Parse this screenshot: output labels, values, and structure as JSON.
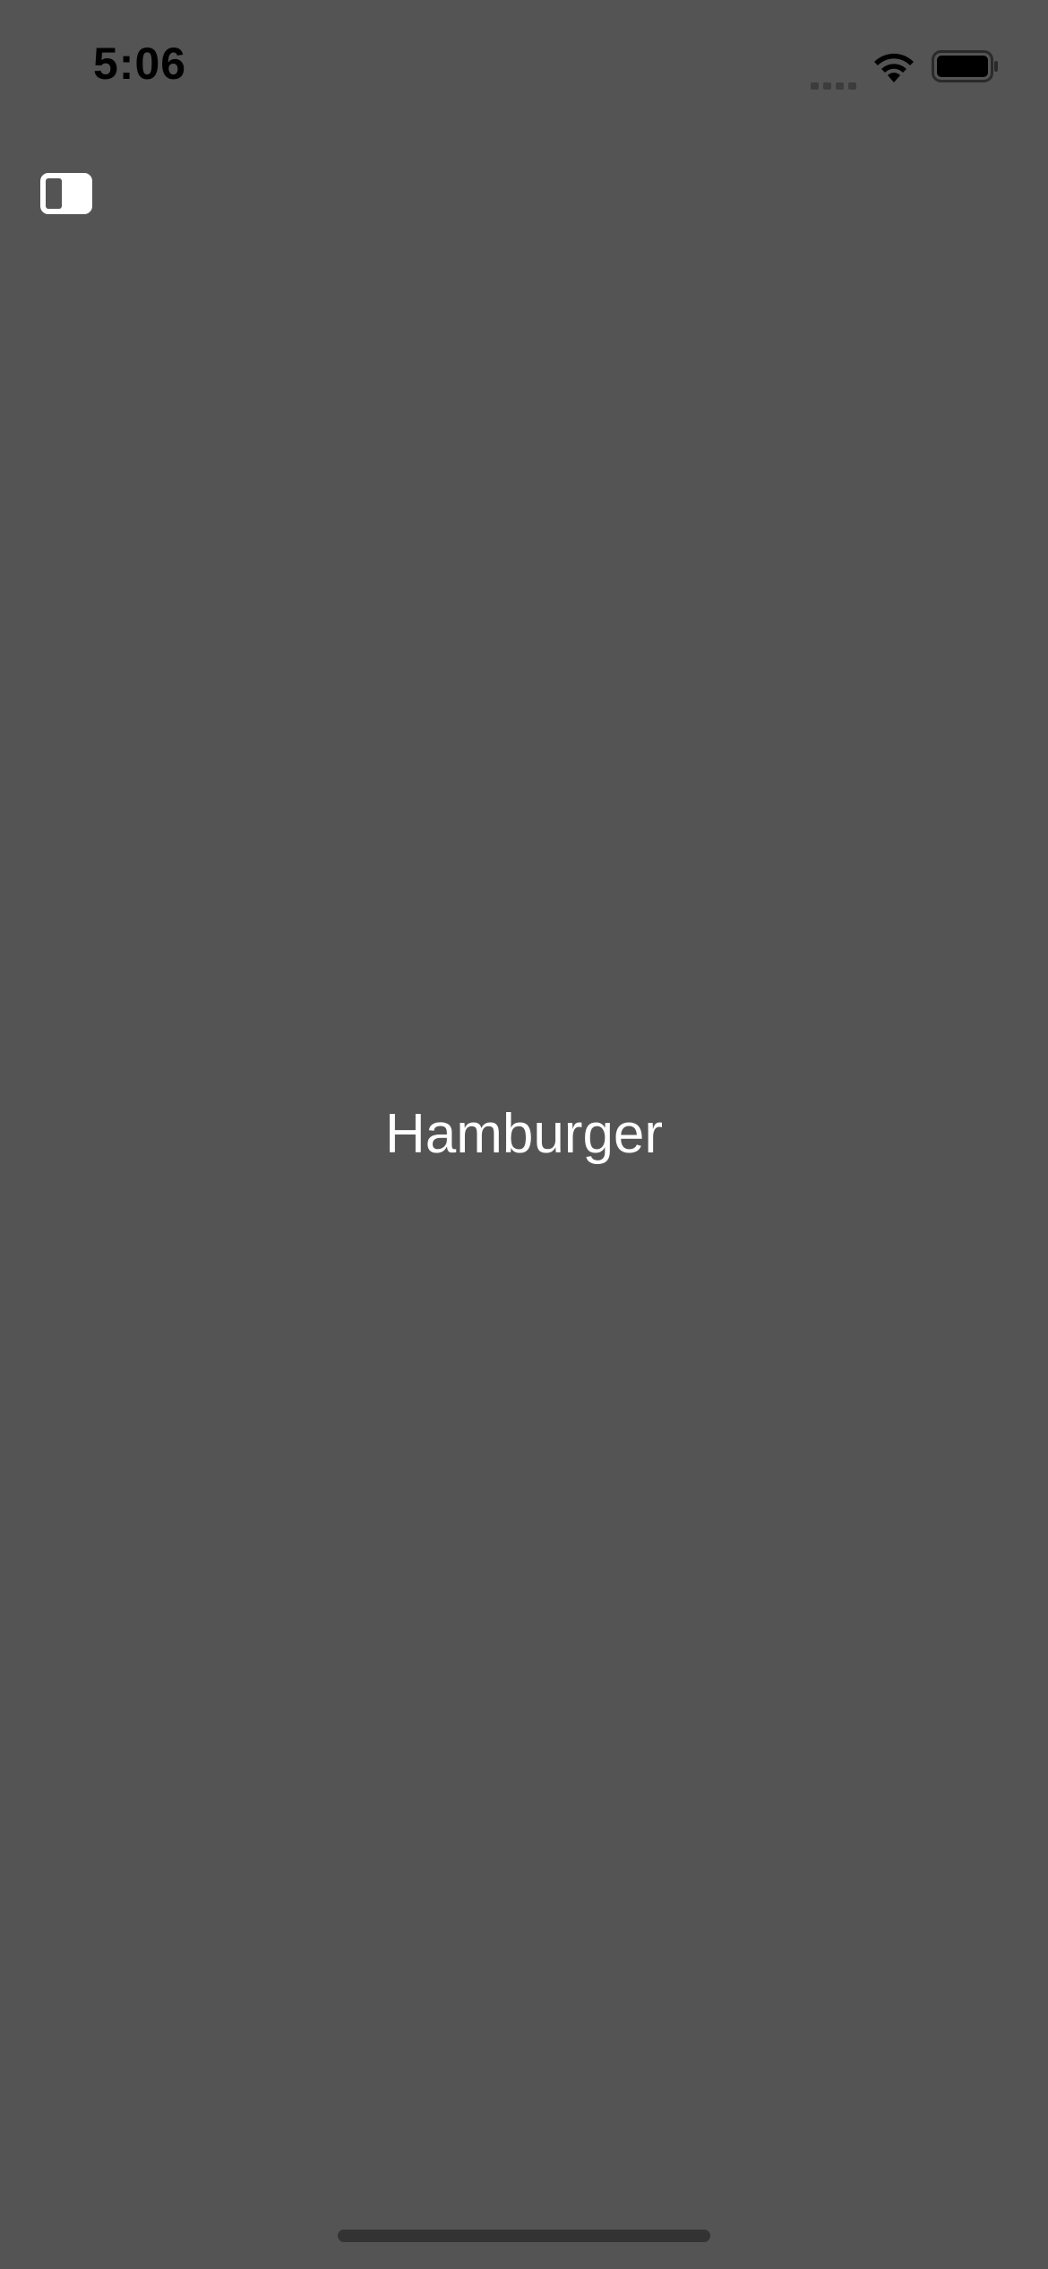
{
  "status_bar": {
    "time": "5:06",
    "icons": [
      "signal-icon",
      "wifi-icon",
      "battery-icon"
    ]
  },
  "toolbar": {
    "sidebar_toggle_icon": "sidebar-toggle-icon"
  },
  "main": {
    "title": "Hamburger"
  },
  "colors": {
    "background": "#545454",
    "text": "#ffffff",
    "status_text": "#000000",
    "home_indicator": "#333333"
  }
}
